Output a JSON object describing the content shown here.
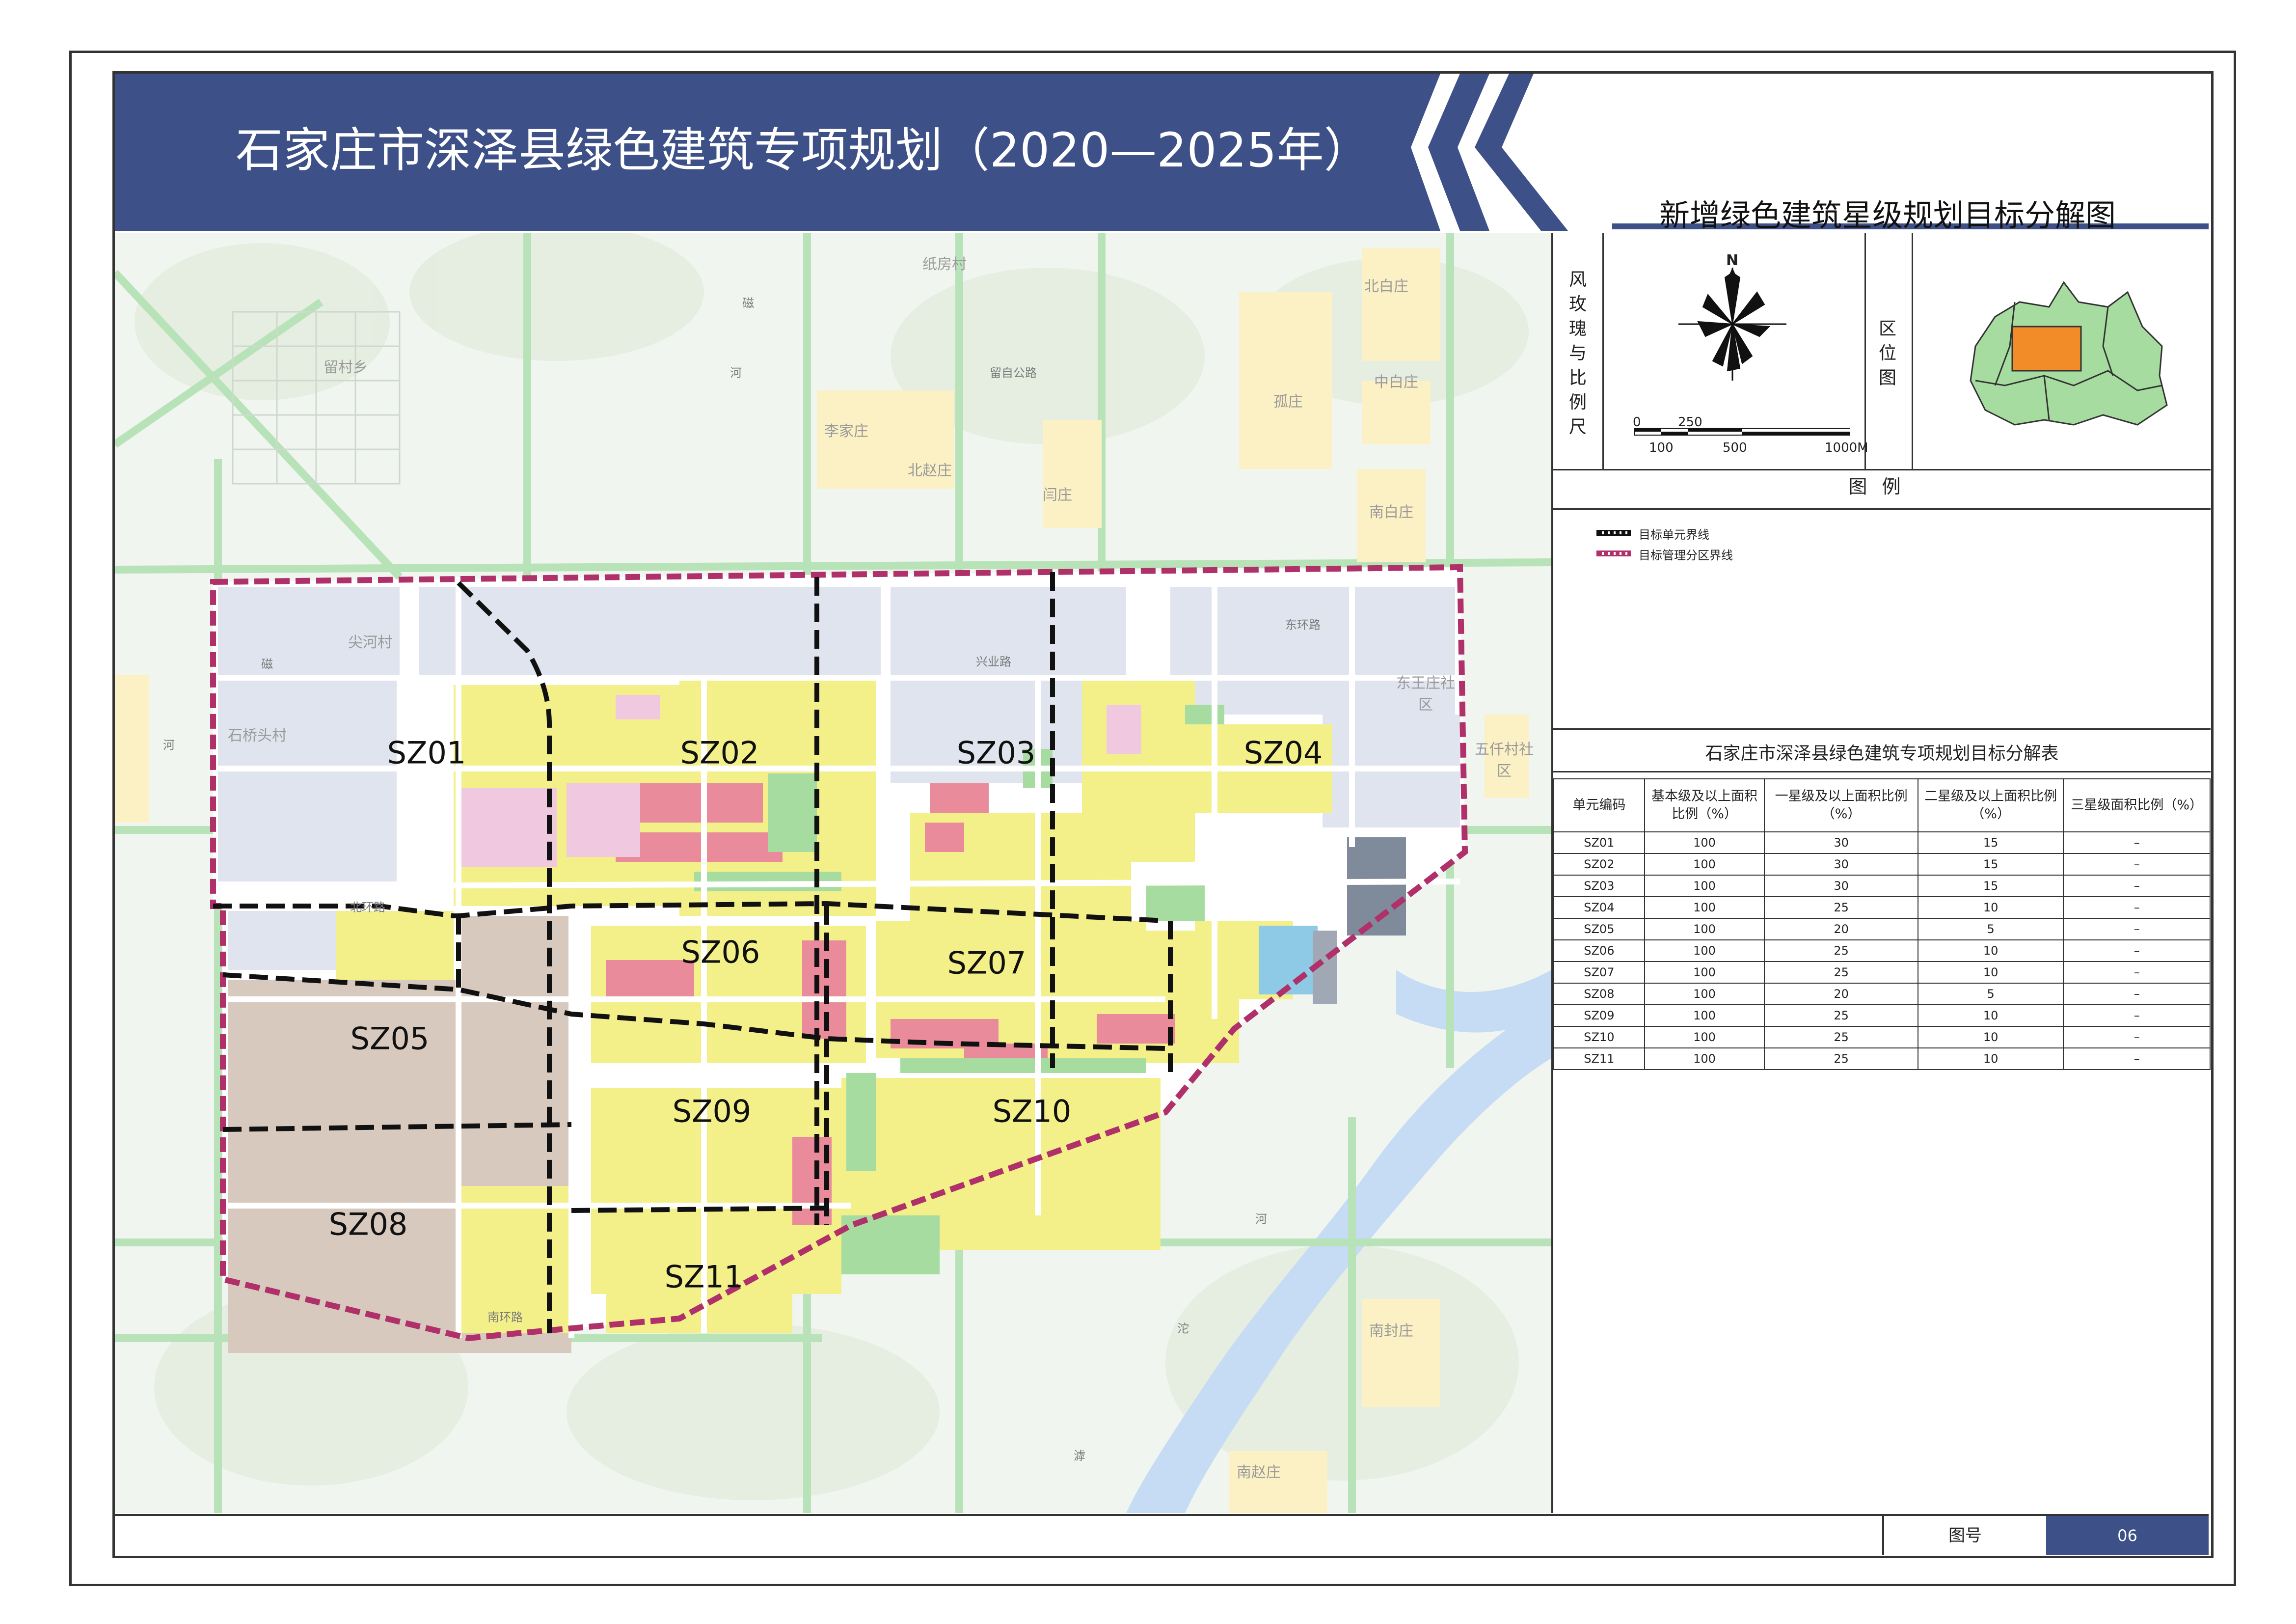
{
  "header": {
    "title": "石家庄市深泽县绿色建筑专项规划（2020—2025年）",
    "subtitle": "新增绿色建筑星级规划目标分解图",
    "band_color": "#3d5087"
  },
  "map": {
    "units": [
      {
        "code": "SZ01"
      },
      {
        "code": "SZ02"
      },
      {
        "code": "SZ03"
      },
      {
        "code": "SZ04"
      },
      {
        "code": "SZ05"
      },
      {
        "code": "SZ06"
      },
      {
        "code": "SZ07"
      },
      {
        "code": "SZ08"
      },
      {
        "code": "SZ09"
      },
      {
        "code": "SZ10"
      },
      {
        "code": "SZ11"
      }
    ],
    "places": [
      "纸房村",
      "北白庄",
      "留村乡",
      "李家庄",
      "北赵庄",
      "闫庄",
      "孤庄",
      "中白庄",
      "南白庄",
      "尖河村",
      "石桥头村",
      "东王庄社区",
      "五仟村社区",
      "南封庄",
      "南赵庄"
    ],
    "roads": [
      "磁",
      "河",
      "留自公路",
      "东环路",
      "北环路",
      "兴业路",
      "磁",
      "河",
      "河",
      "沱",
      "滹",
      "南环路"
    ],
    "colors": {
      "boundary_unit": "#111111",
      "boundary_district": "#b0306a",
      "residential": "#f3f08a",
      "commercial": "#e98b9a",
      "industrial": "#d8c9bf",
      "public": "#f0b8d8",
      "green": "#a7dca0",
      "water": "#c6dcf4",
      "unbuilt": "#dfe4ee"
    }
  },
  "panel": {
    "rose_label": "风玫瑰与比例尺",
    "north": "N",
    "scale_top": [
      "0",
      "250"
    ],
    "scale_bottom": [
      "100",
      "500",
      "1000M"
    ],
    "location_label": "区位图",
    "legend_title": "图例",
    "legend": [
      {
        "label": "目标单元界线"
      },
      {
        "label": "目标管理分区界线"
      }
    ]
  },
  "table": {
    "title": "石家庄市深泽县绿色建筑专项规划目标分解表",
    "headers": [
      "单元编码",
      "基本级及以上面积比例（%）",
      "一星级及以上面积比例（%）",
      "二星级及以上面积比例（%）",
      "三星级面积比例（%）"
    ],
    "rows": [
      [
        "SZ01",
        "100",
        "30",
        "15",
        "–"
      ],
      [
        "SZ02",
        "100",
        "30",
        "15",
        "–"
      ],
      [
        "SZ03",
        "100",
        "30",
        "15",
        "–"
      ],
      [
        "SZ04",
        "100",
        "25",
        "10",
        "–"
      ],
      [
        "SZ05",
        "100",
        "20",
        "5",
        "–"
      ],
      [
        "SZ06",
        "100",
        "25",
        "10",
        "–"
      ],
      [
        "SZ07",
        "100",
        "25",
        "10",
        "–"
      ],
      [
        "SZ08",
        "100",
        "20",
        "5",
        "–"
      ],
      [
        "SZ09",
        "100",
        "25",
        "10",
        "–"
      ],
      [
        "SZ10",
        "100",
        "25",
        "10",
        "–"
      ],
      [
        "SZ11",
        "100",
        "25",
        "10",
        "–"
      ]
    ]
  },
  "footer": {
    "drawing_no_label": "图号",
    "drawing_no": "06"
  }
}
